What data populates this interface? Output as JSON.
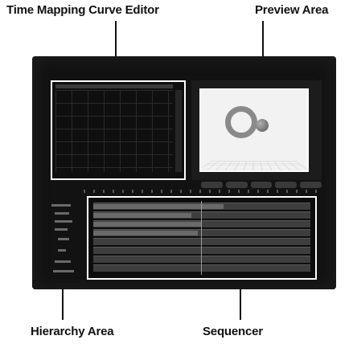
{
  "labels": {
    "curve_editor": "Time Mapping Curve Editor",
    "preview_area": "Preview Area",
    "hierarchy_area": "Hierarchy Area",
    "sequencer": "Sequencer"
  },
  "colors": {
    "screen_bg": "#121212",
    "highlight_border": "#ffffff",
    "preview_bg": "#f2f2f2",
    "callout_text": "#111111"
  },
  "icons": [
    "torus-object-icon",
    "sphere-object-icon"
  ]
}
